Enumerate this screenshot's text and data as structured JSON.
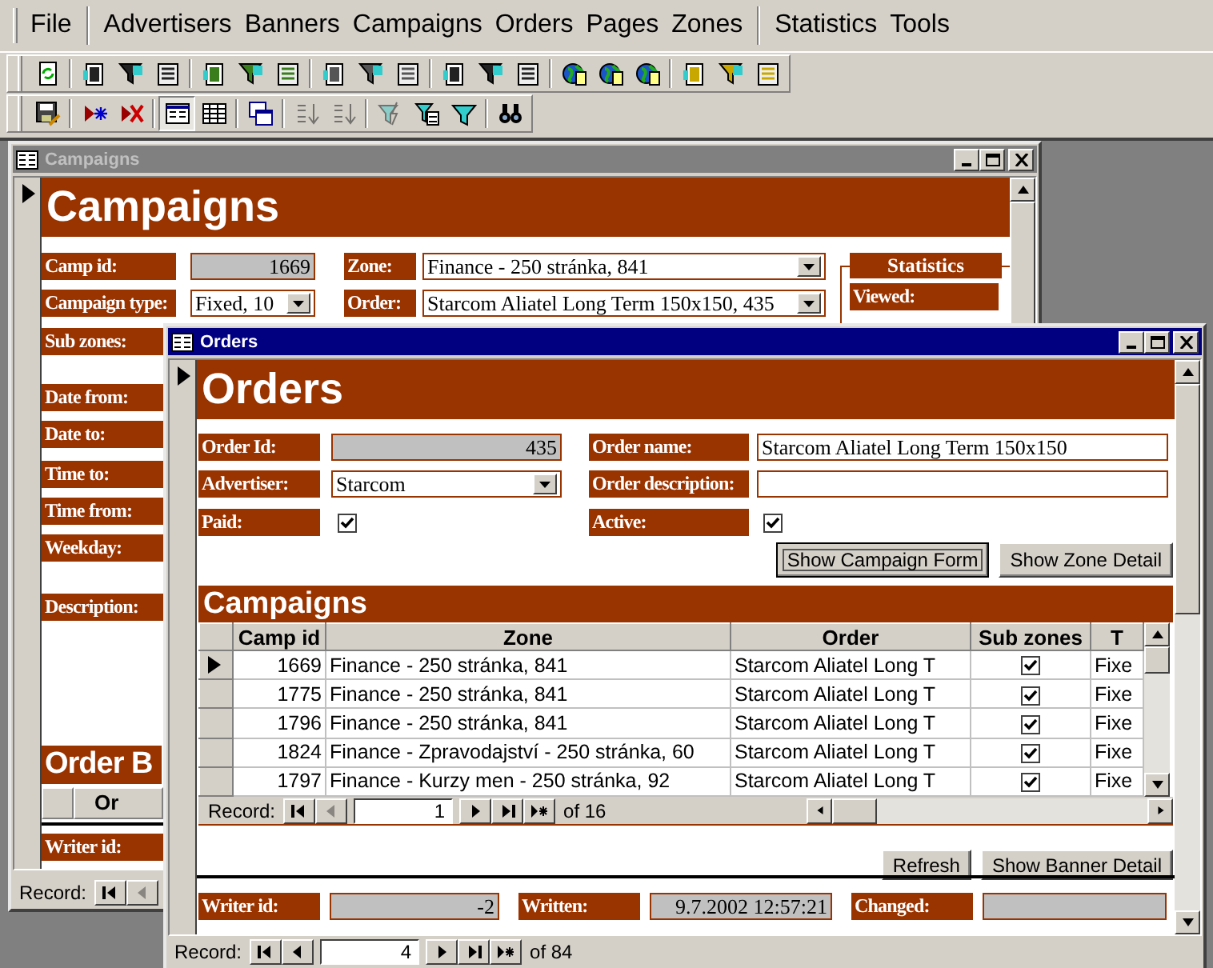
{
  "menu_groups": [
    [
      "File"
    ],
    [
      "Advertisers",
      "Banners",
      "Campaigns",
      "Orders",
      "Pages",
      "Zones"
    ],
    [
      "Statistics",
      "Tools"
    ]
  ],
  "toolbar_rows": [
    [
      [
        {
          "kind": "refresh",
          "disabled": false,
          "pressed": false
        }
      ],
      [
        {
          "kind": "page",
          "disabled": false,
          "pressed": false
        },
        {
          "kind": "funnel",
          "disabled": false,
          "pressed": false
        },
        {
          "kind": "sheet",
          "disabled": false,
          "pressed": false
        }
      ],
      [
        {
          "kind": "page",
          "disabled": false,
          "pressed": false
        },
        {
          "kind": "funnel",
          "disabled": false,
          "pressed": false
        },
        {
          "kind": "sheet",
          "disabled": false,
          "pressed": false
        }
      ],
      [
        {
          "kind": "page",
          "disabled": false,
          "pressed": false
        },
        {
          "kind": "funnel",
          "disabled": false,
          "pressed": false
        },
        {
          "kind": "sheet",
          "disabled": false,
          "pressed": false
        }
      ],
      [
        {
          "kind": "page",
          "disabled": false,
          "pressed": false
        },
        {
          "kind": "funnel",
          "disabled": false,
          "pressed": false
        },
        {
          "kind": "sheet",
          "disabled": false,
          "pressed": false
        }
      ],
      [
        {
          "kind": "globe",
          "disabled": false,
          "pressed": false
        },
        {
          "kind": "globe",
          "disabled": false,
          "pressed": false
        },
        {
          "kind": "globe",
          "disabled": false,
          "pressed": false
        }
      ],
      [
        {
          "kind": "page",
          "disabled": false,
          "pressed": false
        },
        {
          "kind": "funnel",
          "disabled": false,
          "pressed": false
        },
        {
          "kind": "sheet",
          "disabled": false,
          "pressed": false
        }
      ]
    ],
    [
      [
        {
          "kind": "save",
          "disabled": false,
          "pressed": false
        }
      ],
      [
        {
          "kind": "new-record",
          "disabled": false,
          "pressed": false
        },
        {
          "kind": "delete-record",
          "disabled": false,
          "pressed": false
        }
      ],
      [
        {
          "kind": "form-view",
          "disabled": false,
          "pressed": true
        },
        {
          "kind": "datasheet-view",
          "disabled": false,
          "pressed": false
        }
      ],
      [
        {
          "kind": "windows",
          "disabled": false,
          "pressed": false
        }
      ],
      [
        {
          "kind": "sort-ascending",
          "disabled": true,
          "pressed": false
        },
        {
          "kind": "sort-descending",
          "disabled": true,
          "pressed": false
        }
      ],
      [
        {
          "kind": "filter-selection",
          "disabled": true,
          "pressed": false
        },
        {
          "kind": "filter-form",
          "disabled": false,
          "pressed": false
        },
        {
          "kind": "filter",
          "disabled": false,
          "pressed": false
        }
      ],
      [
        {
          "kind": "find",
          "disabled": false,
          "pressed": false
        }
      ]
    ]
  ],
  "campaigns_window": {
    "title": "Campaigns",
    "active": false,
    "heading": "Campaigns",
    "field_rows": [
      [
        {
          "kind": "locked",
          "label": "Camp id:",
          "value": "1669"
        },
        {
          "kind": "combo",
          "label": "Zone:",
          "value": "Finance - 250 stránka, 841"
        }
      ],
      [
        {
          "kind": "combo",
          "label": "Campaign type:",
          "value": "Fixed, 10"
        },
        {
          "kind": "combo",
          "label": "Order:",
          "value": "Starcom Aliatel Long Term 150x150, 435"
        }
      ]
    ],
    "statistics": {
      "title": "Statistics",
      "labels": [
        "Viewed:"
      ]
    },
    "labels": [
      "Sub zones:",
      "Date from:",
      "Date to:",
      "Time to:",
      "Time from:",
      "Weekday:",
      "Description:"
    ],
    "subform": {
      "heading": "Order B",
      "columns": [
        "Or"
      ]
    },
    "footer_labels": [
      "Writer id:"
    ],
    "navigation": {
      "label": "Record:",
      "buttons": [
        {
          "kind": "first",
          "disabled": false
        },
        {
          "kind": "previous",
          "disabled": true
        }
      ]
    }
  },
  "orders_window": {
    "title": "Orders",
    "active": true,
    "heading": "Orders",
    "field_rows": [
      [
        {
          "kind": "locked",
          "label": "Order Id:",
          "value": "435"
        },
        {
          "kind": "text",
          "label": "Order name:",
          "value": "Starcom Aliatel Long Term 150x150"
        }
      ],
      [
        {
          "kind": "combo",
          "label": "Advertiser:",
          "value": "Starcom"
        },
        {
          "kind": "text",
          "label": "Order description:"
        }
      ],
      [
        {
          "kind": "checkbox",
          "label": "Paid:",
          "checked": true
        },
        {
          "kind": "checkbox",
          "label": "Active:",
          "checked": true
        }
      ]
    ],
    "buttons": [
      {
        "label": "Show Campaign Form",
        "focused": true
      },
      {
        "label": "Show Zone Detail",
        "focused": false
      }
    ],
    "subform": {
      "heading": "Campaigns",
      "columns": [
        "Camp id",
        "Zone",
        "Order",
        "Sub zones",
        "T"
      ],
      "rows": [
        {
          "selected": true,
          "camp_id": "1669",
          "zone": "Finance - 250 stránka, 841",
          "order": "Starcom Aliatel Long T",
          "sub_zones": true,
          "column_5": "Fixe"
        },
        {
          "selected": false,
          "camp_id": "1775",
          "zone": "Finance - 250 stránka, 841",
          "order": "Starcom Aliatel Long T",
          "sub_zones": true,
          "column_5": "Fixe"
        },
        {
          "selected": false,
          "camp_id": "1796",
          "zone": "Finance - 250 stránka, 841",
          "order": "Starcom Aliatel Long T",
          "sub_zones": true,
          "column_5": "Fixe"
        },
        {
          "selected": false,
          "camp_id": "1824",
          "zone": "Finance - Zpravodajství - 250 stránka, 60",
          "order": "Starcom Aliatel Long T",
          "sub_zones": true,
          "column_5": "Fixe"
        },
        {
          "selected": false,
          "camp_id": "1797",
          "zone": "Finance - Kurzy men - 250 stránka, 92",
          "order": "Starcom Aliatel Long T",
          "sub_zones": true,
          "column_5": "Fixe"
        }
      ],
      "navigation": {
        "label": "Record:",
        "current": "1",
        "total": "of 16",
        "buttons": [
          {
            "kind": "first",
            "disabled": false
          },
          {
            "kind": "previous",
            "disabled": true
          },
          {
            "kind": "next",
            "disabled": false
          },
          {
            "kind": "last",
            "disabled": false
          },
          {
            "kind": "new",
            "disabled": false
          }
        ]
      }
    },
    "subform_buttons": [
      {
        "label": "Refresh",
        "focused": false
      },
      {
        "label": "Show Banner Detail",
        "focused": false
      }
    ],
    "footer_fields": [
      {
        "kind": "locked",
        "label": "Writer id:",
        "value": "-2"
      },
      {
        "kind": "locked",
        "label": "Written:",
        "value": "9.7.2002 12:57:21"
      },
      {
        "kind": "locked",
        "label": "Changed:"
      }
    ],
    "navigation": {
      "label": "Record:",
      "current": "4",
      "total": "of 84",
      "buttons": [
        {
          "kind": "first",
          "disabled": false
        },
        {
          "kind": "previous",
          "disabled": false
        },
        {
          "kind": "next",
          "disabled": false
        },
        {
          "kind": "last",
          "disabled": false
        },
        {
          "kind": "new",
          "disabled": false
        }
      ]
    }
  }
}
